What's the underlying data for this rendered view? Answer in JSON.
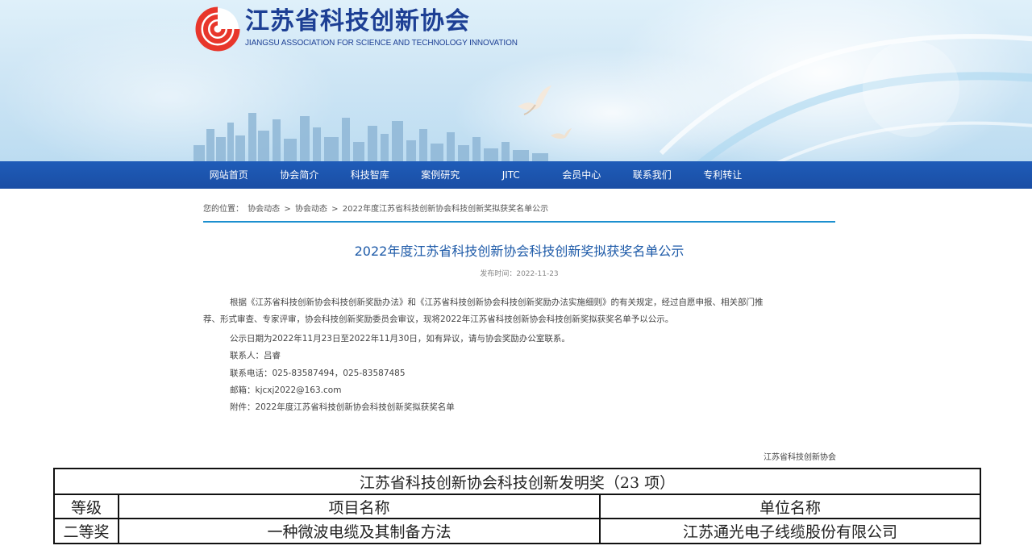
{
  "site": {
    "name_cn": "江苏省科技创新协会",
    "name_en": "JIANGSU ASSOCIATION FOR SCIENCE AND TECHNOLOGY INNOVATION",
    "brand_color": "#1d3f94",
    "logo_color": "#e8362b"
  },
  "nav": {
    "items": [
      {
        "label": "网站首页"
      },
      {
        "label": "协会简介"
      },
      {
        "label": "科技智库"
      },
      {
        "label": "案例研究"
      },
      {
        "label": "JITC"
      },
      {
        "label": "会员中心"
      },
      {
        "label": "联系我们"
      },
      {
        "label": "专利转让"
      }
    ],
    "bg_color": "#1d56ae"
  },
  "breadcrumb": {
    "prefix": "您的位置：",
    "items": [
      "协会动态",
      "协会动态",
      "2022年度江苏省科技创新协会科技创新奖拟获奖名单公示"
    ],
    "separator": ">"
  },
  "article": {
    "title": "2022年度江苏省科技创新协会科技创新奖拟获奖名单公示",
    "published": "发布时间：2022-11-23",
    "paragraph1_line1": "根据《江苏省科技创新协会科技创新奖励办法》和《江苏省科技创新协会科技创新奖励办法实施细则》的有关规定，经过自愿申报、相关部门推",
    "paragraph1_line2": "荐、形式审查、专家评审，协会科技创新奖励委员会审议，现将2022年江苏省科技创新协会科技创新奖拟获奖名单予以公示。",
    "period": "公示日期为2022年11月23日至2022年11月30日，如有异议，请与协会奖励办公室联系。",
    "contact": "联系人：吕睿",
    "phone": "联系电话：025-83587494，025-83587485",
    "email": "邮箱：kjcxj2022@163.com",
    "attachment": "附件：2022年度江苏省科技创新协会科技创新奖拟获奖名单",
    "signoff": "江苏省科技创新协会"
  },
  "award_table": {
    "caption": "江苏省科技创新协会科技创新发明奖（23 项）",
    "headers": [
      "等级",
      "项目名称",
      "单位名称"
    ],
    "rows": [
      [
        "二等奖",
        "一种微波电缆及其制备方法",
        "江苏通光电子线缆股份有限公司"
      ]
    ]
  }
}
